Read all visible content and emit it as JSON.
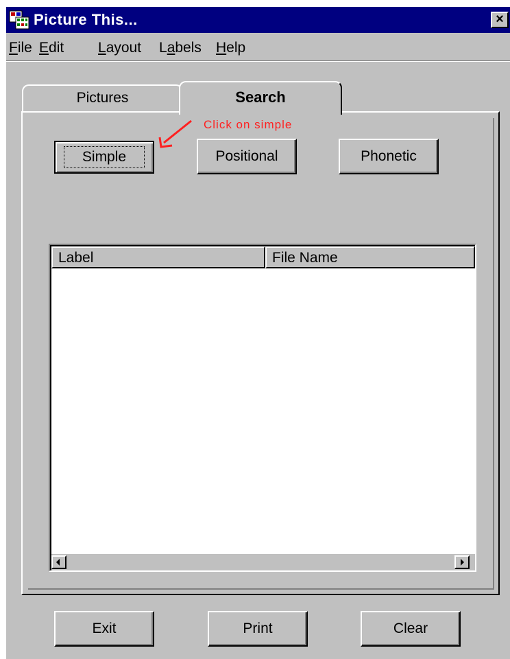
{
  "window": {
    "title": "Picture This...",
    "close_glyph": "×",
    "app_icon": "picture-grid-icon"
  },
  "menu": {
    "items": [
      {
        "acc": "F",
        "rest": "ile"
      },
      {
        "acc": "E",
        "rest": "dit"
      },
      {
        "acc": "L",
        "rest": "ayout"
      },
      {
        "pre": "L",
        "acc": "a",
        "rest": "bels"
      },
      {
        "acc": "H",
        "rest": "elp"
      }
    ]
  },
  "tabs": [
    {
      "label": "Pictures",
      "active": false
    },
    {
      "label": "Search",
      "active": true
    }
  ],
  "annotation": {
    "text": "Click on simple",
    "color": "#ff2020"
  },
  "search_buttons": {
    "simple": "Simple",
    "positional": "Positional",
    "phonetic": "Phonetic"
  },
  "results_list": {
    "columns": [
      "Label",
      "File Name"
    ],
    "rows": []
  },
  "footer_buttons": {
    "exit": "Exit",
    "print": "Print",
    "clear": "Clear"
  },
  "colors": {
    "titlebar": "#000080",
    "face": "#c0c0c0"
  }
}
